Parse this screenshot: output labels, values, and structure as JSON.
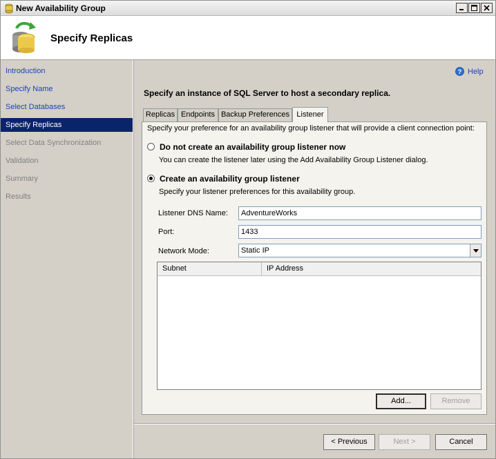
{
  "window": {
    "title": "New Availability Group",
    "icons": {
      "app": "availability-group-icon",
      "header": "database-sync-icon"
    },
    "controls": [
      "minimize",
      "maximize",
      "close"
    ]
  },
  "header": {
    "title": "Specify Replicas"
  },
  "sidebar": {
    "items": [
      {
        "label": "Introduction",
        "state": "link"
      },
      {
        "label": "Specify Name",
        "state": "link"
      },
      {
        "label": "Select Databases",
        "state": "link"
      },
      {
        "label": "Specify Replicas",
        "state": "selected"
      },
      {
        "label": "Select Data Synchronization",
        "state": "disabled"
      },
      {
        "label": "Validation",
        "state": "disabled"
      },
      {
        "label": "Summary",
        "state": "disabled"
      },
      {
        "label": "Results",
        "state": "disabled"
      }
    ]
  },
  "main": {
    "help_label": "Help",
    "instruction": "Specify an instance of SQL Server to host a secondary replica.",
    "tabs": [
      {
        "label": "Replicas"
      },
      {
        "label": "Endpoints"
      },
      {
        "label": "Backup Preferences"
      },
      {
        "label": "Listener",
        "active": true
      }
    ],
    "listener": {
      "intro": "Specify your preference for an availability group listener that will provide a client connection point:",
      "option_no_listener": {
        "label": "Do not create an availability group listener now",
        "description": "You can create the listener later using the Add Availability Group Listener dialog.",
        "checked": false
      },
      "option_create": {
        "label": "Create an availability group listener",
        "description": "Specify your listener preferences for this availability group.",
        "checked": true
      },
      "dns_name_label": "Listener DNS Name:",
      "dns_name_value": "AdventureWorks",
      "port_label": "Port:",
      "port_value": "1433",
      "network_mode_label": "Network Mode:",
      "network_mode_value": "Static IP",
      "grid_columns": [
        "Subnet",
        "IP Address"
      ],
      "grid_rows": [],
      "add_button": "Add...",
      "remove_button": "Remove"
    }
  },
  "footer": {
    "previous": "< Previous",
    "next": "Next >",
    "cancel": "Cancel"
  },
  "colors": {
    "selection": "#0a246a",
    "link": "#1b3fbf",
    "dialog_bg": "#d4d0c8",
    "panel_bg": "#f4f3ee"
  }
}
